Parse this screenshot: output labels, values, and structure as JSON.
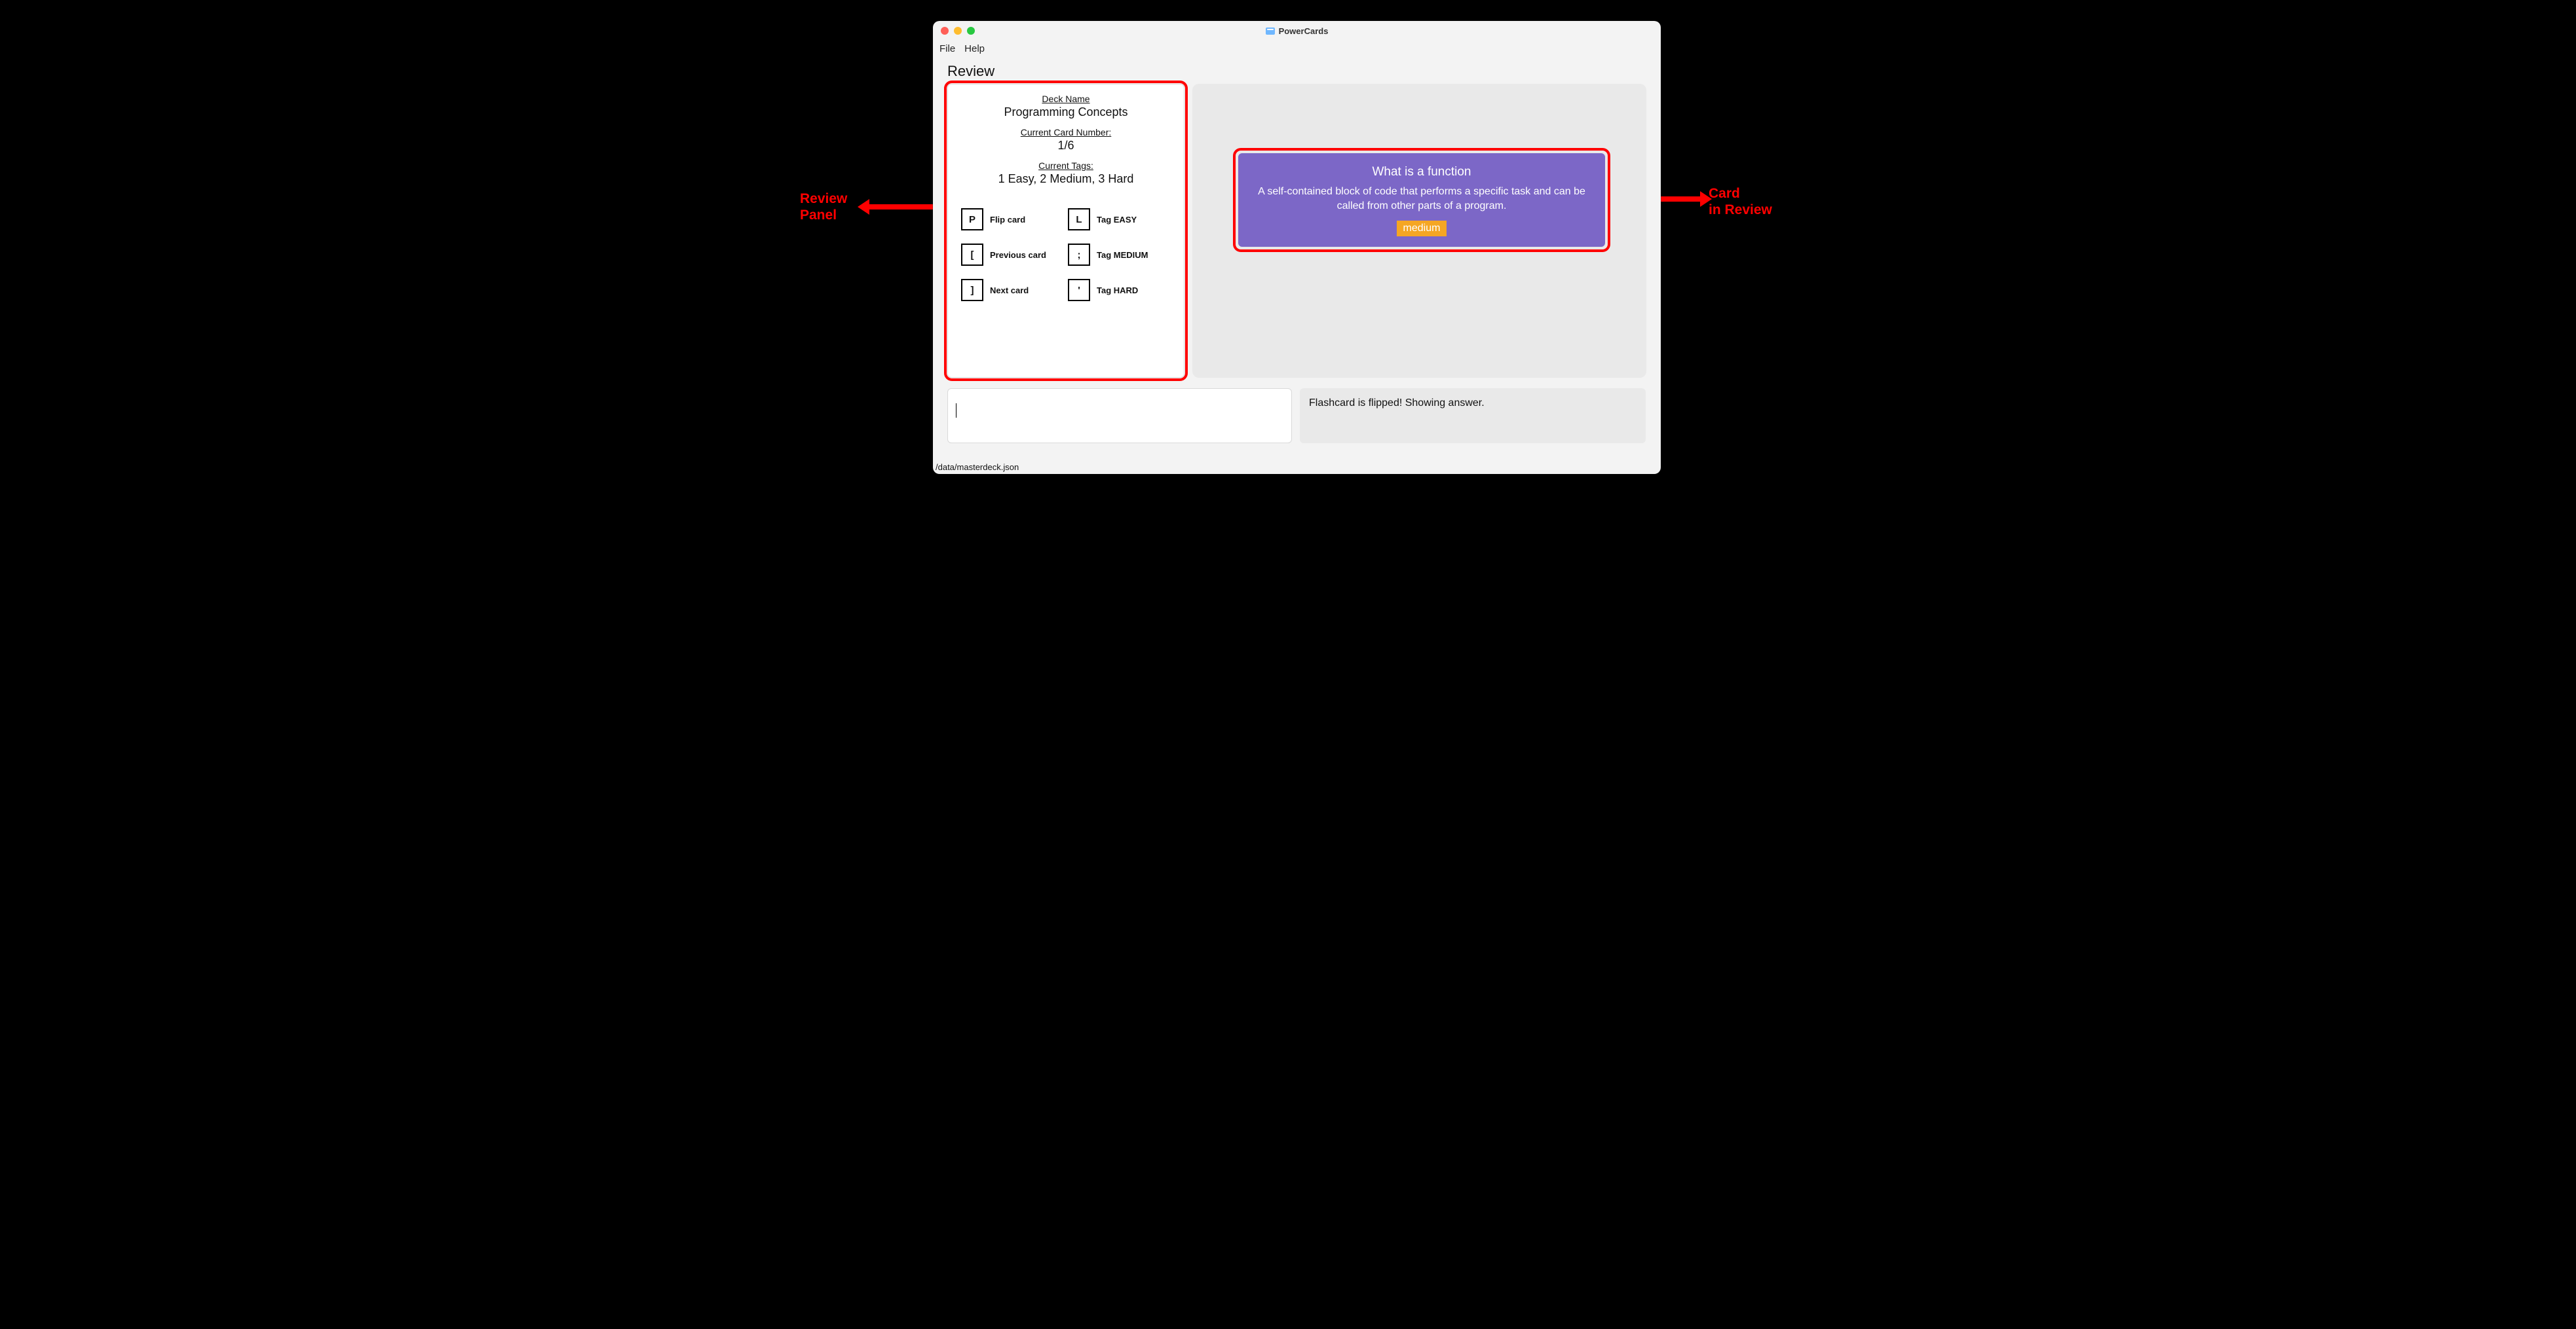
{
  "annotations": {
    "left_label": "Review Panel",
    "right_label": "Card in Review"
  },
  "window": {
    "app_title": "PowerCards",
    "menu": {
      "file": "File",
      "help": "Help"
    }
  },
  "page": {
    "title": "Review"
  },
  "review_panel": {
    "deck_name_label": "Deck Name",
    "deck_name_value": "Programming Concepts",
    "card_number_label": "Current Card Number:",
    "card_number_value": "1/6",
    "tags_label": "Current Tags:",
    "tags_value": "1 Easy, 2 Medium, 3 Hard",
    "shortcuts": {
      "flip": {
        "key": "P",
        "label": "Flip card"
      },
      "easy": {
        "key": "L",
        "label": "Tag EASY"
      },
      "prev": {
        "key": "[",
        "label": "Previous card"
      },
      "medium": {
        "key": ";",
        "label": "Tag MEDIUM"
      },
      "next": {
        "key": "]",
        "label": "Next card"
      },
      "hard": {
        "key": "'",
        "label": "Tag HARD"
      }
    }
  },
  "card": {
    "question": "What is a function",
    "answer": "A self-contained block of code that performs a specific task and can be called from other parts of a program.",
    "badge": "medium"
  },
  "command_input": {
    "value": ""
  },
  "status": {
    "message": "Flashcard is flipped! Showing answer."
  },
  "footer": {
    "path": "/data/masterdeck.json"
  },
  "colors": {
    "card_purple": "#7c67c7",
    "badge_orange": "#f5a623",
    "annotate_red": "#ff0000"
  }
}
